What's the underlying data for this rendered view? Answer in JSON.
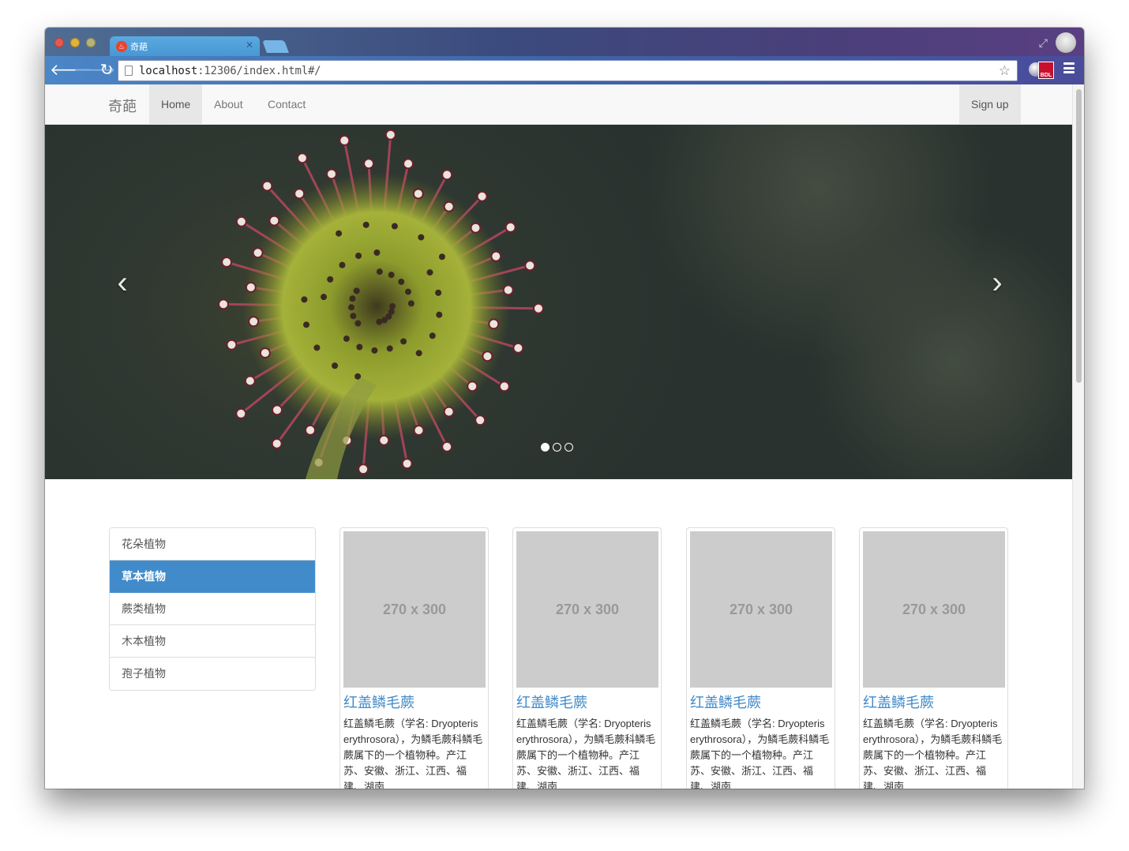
{
  "browser": {
    "tab_title": "奇葩",
    "tab_favicon": "♨",
    "url_host": "localhost",
    "url_rest": ":12306/index.html#/"
  },
  "navbar": {
    "brand": "奇葩",
    "links": [
      "Home",
      "About",
      "Contact"
    ],
    "signup": "Sign up"
  },
  "carousel": {
    "prev_glyph": "‹",
    "next_glyph": "›",
    "slide_count": 3,
    "active_slide": 1
  },
  "sidebar": {
    "items": [
      "花朵植物",
      "草本植物",
      "蕨类植物",
      "木本植物",
      "孢子植物"
    ],
    "active_index": 1
  },
  "products": [
    {
      "placeholder": "270 x 300",
      "title": "红盖鳞毛蕨",
      "desc": "红盖鳞毛蕨（学名: Dryopteris erythrosora），为鳞毛蕨科鳞毛蕨属下的一个植物种。产江苏、安徽、浙江、江西、福建、湖南"
    },
    {
      "placeholder": "270 x 300",
      "title": "红盖鳞毛蕨",
      "desc": "红盖鳞毛蕨（学名: Dryopteris erythrosora），为鳞毛蕨科鳞毛蕨属下的一个植物种。产江苏、安徽、浙江、江西、福建、湖南"
    },
    {
      "placeholder": "270 x 300",
      "title": "红盖鳞毛蕨",
      "desc": "红盖鳞毛蕨（学名: Dryopteris erythrosora），为鳞毛蕨科鳞毛蕨属下的一个植物种。产江苏、安徽、浙江、江西、福建、湖南"
    },
    {
      "placeholder": "270 x 300",
      "title": "红盖鳞毛蕨",
      "desc": "红盖鳞毛蕨（学名: Dryopteris erythrosora），为鳞毛蕨科鳞毛蕨属下的一个植物种。产江苏、安徽、浙江、江西、福建、湖南"
    }
  ],
  "colors": {
    "accent": "#428bca",
    "navbar_bg": "#f8f8f8",
    "placeholder_bg": "#cccccc"
  },
  "icons": {
    "back": "back-arrow-icon",
    "forward": "forward-arrow-icon",
    "reload": "reload-icon",
    "bookmark": "star-icon",
    "menu": "hamburger-menu-icon",
    "incognito": "incognito-icon"
  }
}
